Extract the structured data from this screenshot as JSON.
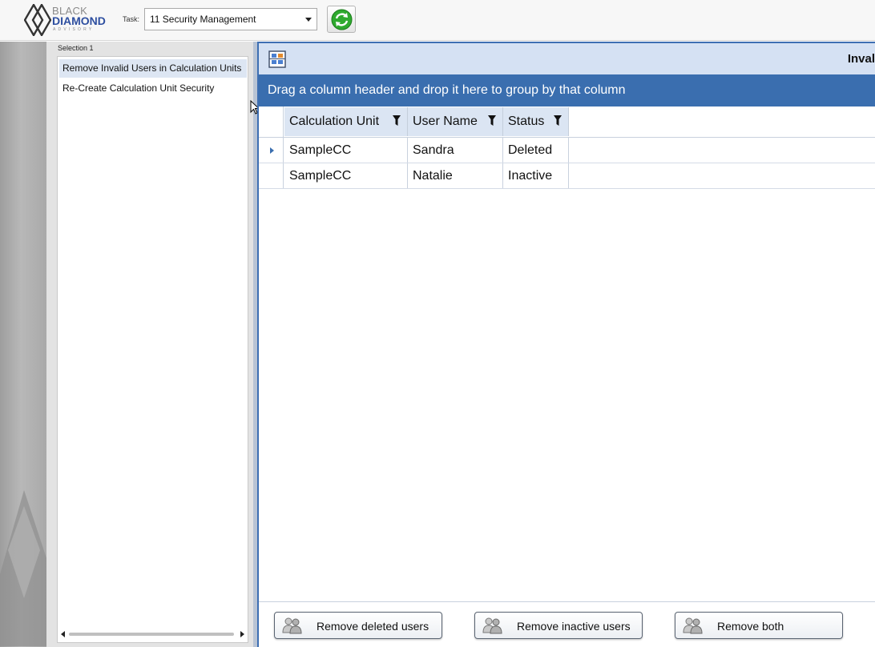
{
  "app": {
    "logo": {
      "line1": "BLACK",
      "line2": "DIAMOND",
      "line3": "ADVISORY"
    },
    "task_label": "Task:",
    "task_value": "11 Security Management"
  },
  "selection": {
    "title": "Selection 1",
    "items": [
      {
        "label": "Remove Invalid Users in Calculation Units",
        "active": true
      },
      {
        "label": "Re-Create Calculation Unit Security",
        "active": false
      }
    ]
  },
  "main": {
    "title": "Inval",
    "group_hint": "Drag a column header and drop it here to group by that column",
    "columns": [
      "Calculation Unit",
      "User Name",
      "Status"
    ],
    "rows": [
      {
        "calc_unit": "SampleCC",
        "user_name": "Sandra",
        "status": "Deleted"
      },
      {
        "calc_unit": "SampleCC",
        "user_name": "Natalie",
        "status": "Inactive"
      }
    ]
  },
  "actions": {
    "remove_deleted": "Remove deleted users",
    "remove_inactive": "Remove inactive users",
    "remove_both": "Remove both"
  },
  "icons": {
    "logo": "diamond-logo-icon",
    "refresh": "refresh-icon",
    "export": "export-grid-icon",
    "filter": "filter-icon",
    "users": "users-icon"
  },
  "colors": {
    "accent": "#3a6eaf",
    "header_bg": "#d5e1f3",
    "selected_item": "#dde6f3",
    "refresh_green": "#2faa2f"
  }
}
